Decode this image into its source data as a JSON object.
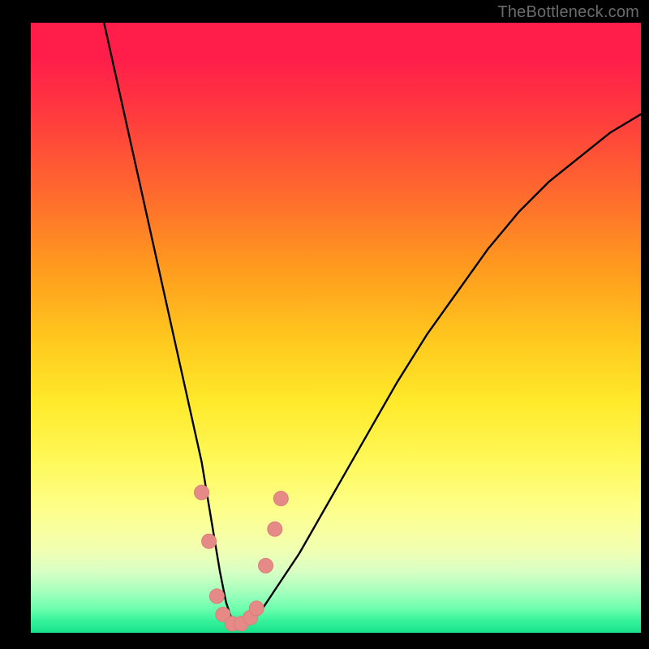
{
  "watermark": "TheBottleneck.com",
  "colors": {
    "gradient_top": "#ff1e4a",
    "gradient_bottom": "#18e28c",
    "curve": "#000000",
    "marker_fill": "#e58a86",
    "marker_stroke": "#d97e7a"
  },
  "chart_data": {
    "type": "line",
    "title": "",
    "xlabel": "",
    "ylabel": "",
    "xlim": [
      0,
      100
    ],
    "ylim": [
      0,
      100
    ],
    "grid": false,
    "legend": "none",
    "series": [
      {
        "name": "curve",
        "x": [
          12,
          14,
          16,
          18,
          20,
          22,
          24,
          26,
          28,
          29,
          30,
          31,
          32,
          33,
          34,
          35,
          36,
          38,
          40,
          44,
          48,
          52,
          56,
          60,
          65,
          70,
          75,
          80,
          85,
          90,
          95,
          100
        ],
        "values": [
          100,
          91,
          82,
          73,
          64,
          55,
          46,
          37,
          28,
          22,
          16,
          10,
          5,
          2,
          1,
          1,
          2,
          4,
          7,
          13,
          20,
          27,
          34,
          41,
          49,
          56,
          63,
          69,
          74,
          78,
          82,
          85
        ]
      }
    ],
    "markers": [
      {
        "x": 28.0,
        "y": 23.0
      },
      {
        "x": 29.2,
        "y": 15.0
      },
      {
        "x": 30.5,
        "y": 6.0
      },
      {
        "x": 31.5,
        "y": 3.0
      },
      {
        "x": 33.0,
        "y": 1.5
      },
      {
        "x": 34.5,
        "y": 1.5
      },
      {
        "x": 36.0,
        "y": 2.5
      },
      {
        "x": 37.0,
        "y": 4.0
      },
      {
        "x": 38.5,
        "y": 11.0
      },
      {
        "x": 40.0,
        "y": 17.0
      },
      {
        "x": 41.0,
        "y": 22.0
      }
    ]
  }
}
